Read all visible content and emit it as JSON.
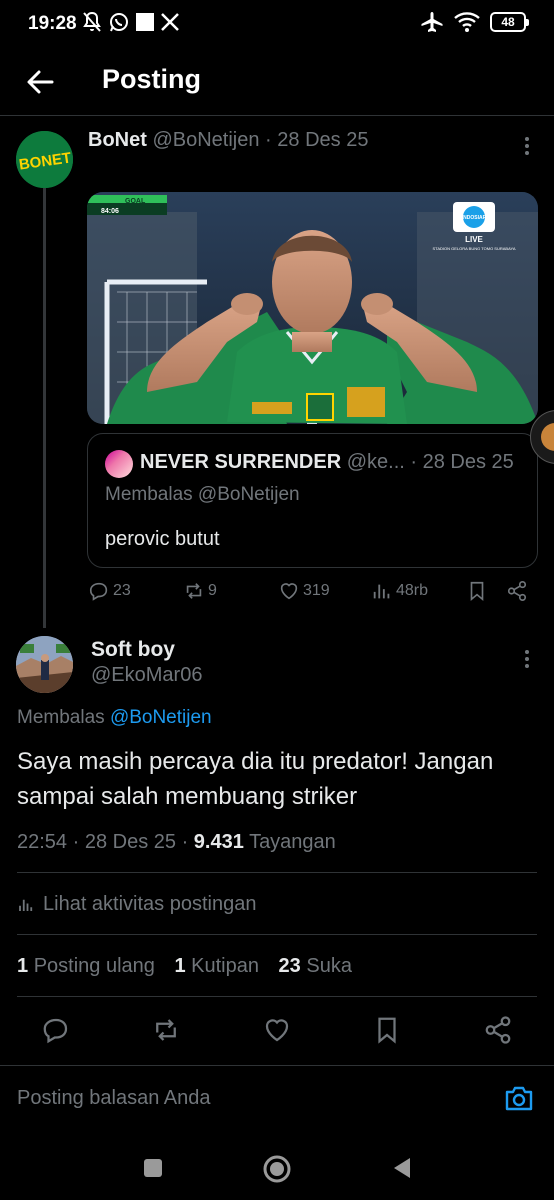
{
  "status_bar": {
    "time": "19:28",
    "battery": "48"
  },
  "header": {
    "title": "Posting"
  },
  "parent_post": {
    "author_name": "BoNet",
    "handle": "@BoNetijen",
    "date": "· 28 Des 25",
    "avatar_text": "BONET",
    "media": {
      "score_label": "GOAL",
      "match_time": "84:06",
      "broadcaster": "INDOSIAR",
      "live_label": "LIVE",
      "venue": "STADION GELORA BUNG TOMO SURABAYA"
    },
    "quote": {
      "author_name": "NEVER SURRENDER",
      "handle": "@ke...",
      "date": "· 28 Des 25",
      "replying_to": "Membalas @BoNetijen",
      "text": "perovic butut"
    },
    "actions": {
      "replies": "23",
      "reposts": "9",
      "likes": "319",
      "views": "48rb"
    }
  },
  "main_post": {
    "author_name": "Soft boy",
    "handle": "@EkoMar06",
    "replying_prefix": "Membalas",
    "replying_handle": "@BoNetijen",
    "text": "Saya masih percaya dia itu predator! Jangan sampai salah membuang striker",
    "time": "22:54",
    "date": "· 28 Des 25 ·",
    "views_count": "9.431",
    "views_label": "Tayangan",
    "activity_label": "Lihat aktivitas postingan",
    "stats": {
      "reposts_count": "1",
      "reposts_label": "Posting ulang",
      "quotes_count": "1",
      "quotes_label": "Kutipan",
      "likes_count": "23",
      "likes_label": "Suka"
    }
  },
  "reply_bar": {
    "placeholder": "Posting balasan Anda"
  },
  "colors": {
    "background": "#000000",
    "text": "#e7e9ea",
    "muted": "#71767b",
    "accent": "#1d9bf0",
    "border": "#2f3336"
  }
}
